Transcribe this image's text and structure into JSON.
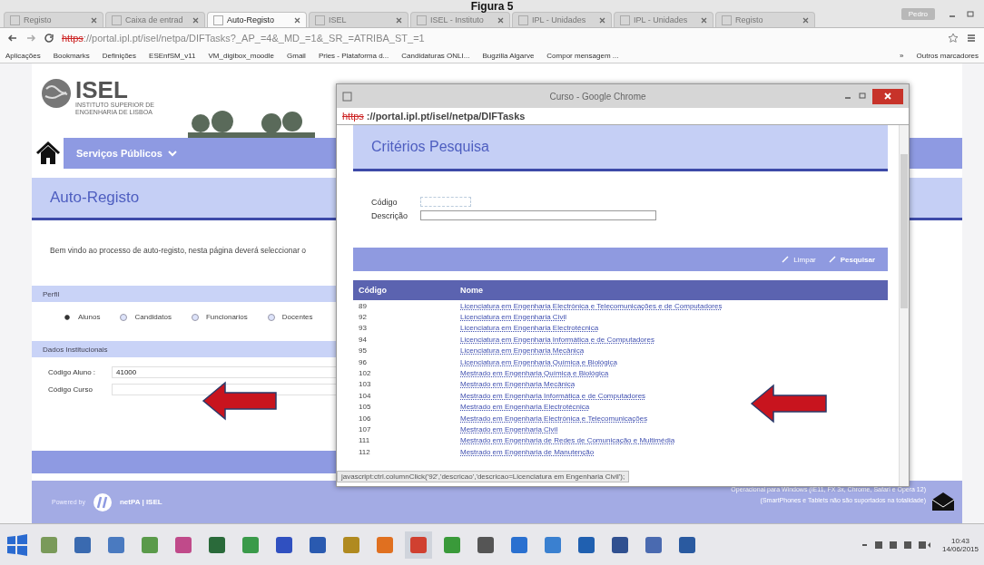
{
  "figure_caption": "Figura 5",
  "browser": {
    "tabs": [
      {
        "label": "Registo",
        "selected": false
      },
      {
        "label": "Caixa de entrad",
        "selected": false
      },
      {
        "label": "Auto-Registo",
        "selected": true
      },
      {
        "label": "ISEL",
        "selected": false
      },
      {
        "label": "ISEL - Instituto",
        "selected": false
      },
      {
        "label": "IPL - Unidades",
        "selected": false
      },
      {
        "label": "IPL - Unidades",
        "selected": false
      },
      {
        "label": "Registo",
        "selected": false
      }
    ],
    "profile": "Pedro",
    "url_scheme": "https",
    "url_rest": "://portal.ipl.pt/isel/netpa/DIFTasks?_AP_=4&_MD_=1&_SR_=ATRIBA_ST_=1",
    "bookmarks": [
      "Aplicações",
      "Bookmarks",
      "Definições",
      "ESEnfSM_v11",
      "VM_digibox_moodle",
      "Gmail",
      "Pries - Plataforma d...",
      "Candidaturas ONLI...",
      "Bugzilla Algarve",
      "Compor mensagem ..."
    ],
    "more": "»",
    "other_bookmarks": "Outros marcadores"
  },
  "page": {
    "logo_name": "ISEL",
    "logo_subtitle": "INSTITUTO SUPERIOR DE ENGENHARIA DE LISBOA",
    "nav": "Serviços Públicos",
    "title": "Auto-Registo",
    "intro": "Bem vindo ao processo de auto-registo, nesta página deverá seleccionar o",
    "perfil": {
      "title": "Perfil",
      "options": [
        {
          "label": "Alunos",
          "selected": true
        },
        {
          "label": "Candidatos",
          "selected": false
        },
        {
          "label": "Funcionarios",
          "selected": false
        },
        {
          "label": "Docentes",
          "selected": false
        }
      ]
    },
    "dados": {
      "title": "Dados Institucionais",
      "fields": [
        {
          "label": "Código Aluno :",
          "value": "41000"
        },
        {
          "label": "Código Curso"
        }
      ]
    },
    "footer": {
      "powered_by": "Powered by",
      "brand": "netPA | ISEL",
      "notes": [
        "Operacional para Windows (IE11, FX 3x, Chrome, Safari e Opera 12)",
        "(SmartPhones e Tablets não são suportados na totalidade)"
      ]
    }
  },
  "popup": {
    "title": "Curso - Google Chrome",
    "url_scheme": "https",
    "url_rest": "://portal.ipl.pt/isel/netpa/DIFTasks",
    "heading": "Critérios Pesquisa",
    "fields": [
      {
        "label": "Código"
      },
      {
        "label": "Descrição"
      }
    ],
    "actions": [
      "Limpar",
      "Pesquisar"
    ],
    "table": {
      "columns": [
        "Código",
        "Nome"
      ],
      "rows": [
        {
          "code": "89",
          "name": "Licenciatura em Engenharia Electrónica e Telecomunicações e de Computadores"
        },
        {
          "code": "92",
          "name": "Licenciatura em Engenharia Civil"
        },
        {
          "code": "93",
          "name": "Licenciatura em Engenharia Electrotécnica"
        },
        {
          "code": "94",
          "name": "Licenciatura em Engenharia Informática e de Computadores"
        },
        {
          "code": "95",
          "name": "Licenciatura em Engenharia Mecânica"
        },
        {
          "code": "96",
          "name": "Licenciatura em Engenharia Química e Biológica"
        },
        {
          "code": "102",
          "name": "Mestrado em Engenharia Química e Biológica"
        },
        {
          "code": "103",
          "name": "Mestrado em Engenharia Mecânica"
        },
        {
          "code": "104",
          "name": "Mestrado em Engenharia Informática e de Computadores"
        },
        {
          "code": "105",
          "name": "Mestrado em Engenharia Electrotécnica"
        },
        {
          "code": "106",
          "name": "Mestrado em Engenharia Electrónica e Telecomunicações"
        },
        {
          "code": "107",
          "name": "Mestrado em Engenharia Civil"
        },
        {
          "code": "111",
          "name": "Mestrado em Engenharia de Redes de Comunicação e Multimédia"
        },
        {
          "code": "112",
          "name": "Mestrado em Engenharia de Manutenção"
        }
      ]
    },
    "status": "javascript:ctrl.columnClick('92','descricao','descricao=Licenciatura em Engenharia Civil');"
  },
  "taskbar": {
    "time": "10:43",
    "date": "14/06/2015"
  }
}
